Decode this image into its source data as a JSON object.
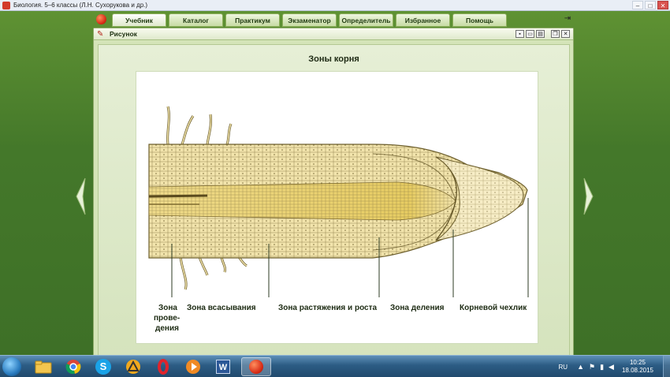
{
  "window": {
    "title": "Биология. 5–6 классы (Л.Н. Сухорукова и др.)",
    "controls": [
      "–",
      "□",
      "✕"
    ]
  },
  "tabs": [
    {
      "label": "Учебник",
      "active": true
    },
    {
      "label": "Каталог",
      "active": false
    },
    {
      "label": "Практикум",
      "active": false
    },
    {
      "label": "Экзаменатор",
      "active": false
    },
    {
      "label": "Определитель",
      "active": false
    },
    {
      "label": "Избранное",
      "active": false
    },
    {
      "label": "Помощь",
      "active": false
    }
  ],
  "panel": {
    "title": "Рисунок"
  },
  "figure": {
    "title": "Зоны корня",
    "labels": {
      "conduction_1": "Зона",
      "conduction_2": "прове-",
      "conduction_3": "дения",
      "absorption": "Зона всасывания",
      "elongation": "Зона растяжения и роста",
      "division": "Зона деления",
      "root_cap": "Корневой чехлик"
    }
  },
  "taskbar": {
    "items": [
      {
        "name": "explorer",
        "icon": "folder-icon"
      },
      {
        "name": "chrome",
        "icon": "chrome-icon"
      },
      {
        "name": "skype",
        "icon": "skype-icon",
        "glyph": "S"
      },
      {
        "name": "app-triangle",
        "icon": "triangle-app-icon"
      },
      {
        "name": "opera",
        "icon": "opera-icon",
        "glyph": "O"
      },
      {
        "name": "media-player",
        "icon": "play-icon"
      },
      {
        "name": "word",
        "icon": "word-icon",
        "glyph": "W"
      },
      {
        "name": "biology-app",
        "icon": "tomato-icon"
      }
    ],
    "language": "RU",
    "time": "10:25",
    "date": "18.08.2015"
  },
  "colors": {
    "frame_green": "#44782a",
    "panel_bg": "#d4e4b8",
    "root_fill": "#f2e4ac",
    "root_core": "#e6cd6e",
    "taskbar": "#2c5c84"
  }
}
